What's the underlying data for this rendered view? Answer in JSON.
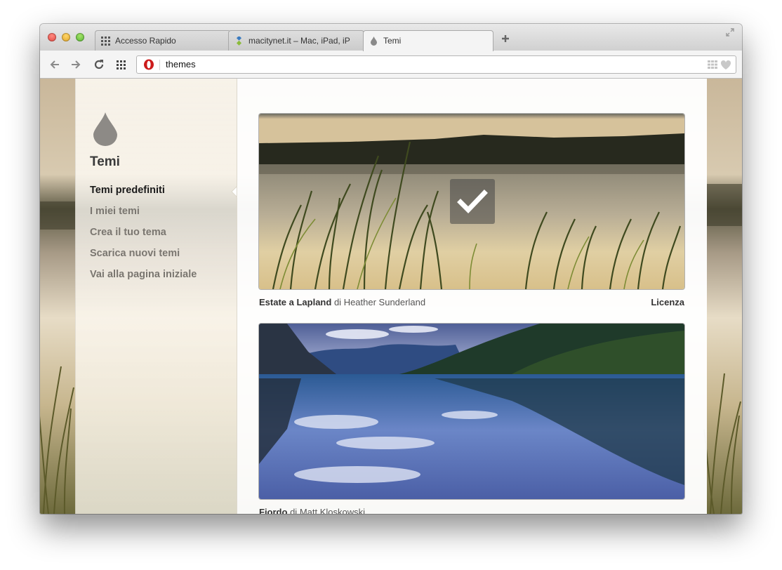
{
  "tabs": [
    {
      "label": "Accesso Rapido",
      "icon": "speed-dial-grid-icon"
    },
    {
      "label": "macitynet.it – Mac, iPad, iP",
      "icon": "macitynet-favicon-icon"
    },
    {
      "label": "Temi",
      "icon": "water-drop-icon"
    }
  ],
  "address_bar": {
    "value": "themes"
  },
  "sidebar": {
    "title": "Temi",
    "nav": [
      {
        "label": "Temi predefiniti",
        "current": true
      },
      {
        "label": "I miei temi"
      },
      {
        "label": "Crea il tuo tema"
      },
      {
        "label": "Scarica nuovi temi"
      },
      {
        "label": "Vai alla pagina iniziale"
      }
    ]
  },
  "themes": [
    {
      "name": "Estate a Lapland",
      "by": "di",
      "author": "Heather Sunderland",
      "license": "Licenza",
      "selected": true
    },
    {
      "name": "Fiordo",
      "by": "di",
      "author": "Matt Kloskowski"
    }
  ]
}
